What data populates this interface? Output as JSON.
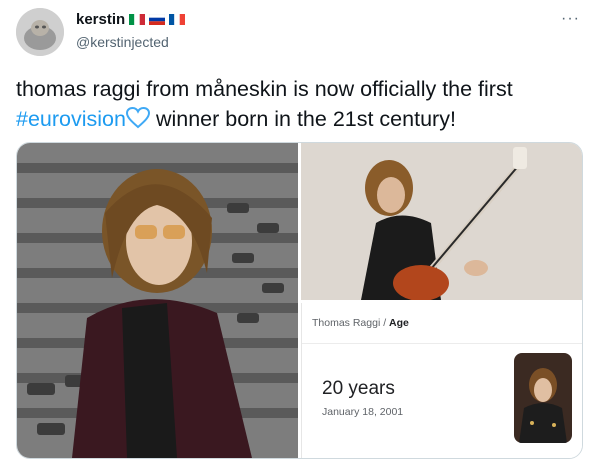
{
  "tweet": {
    "display_name": "kerstin",
    "flags": [
      "italy-flag",
      "russia-flag",
      "france-flag"
    ],
    "handle": "@kerstinjected",
    "more_label": "···",
    "text_line1": "thomas raggi from måneskin is now officially the first",
    "hashtag": "#eurovision",
    "heart_icon": "blue-heart-icon",
    "text_line2_rest": " winner born in the 21st century!"
  },
  "card": {
    "breadcrumb_name": "Thomas Raggi",
    "breadcrumb_sep": "/",
    "breadcrumb_topic": "Age",
    "age": "20 years",
    "birth_date": "January 18, 2001"
  },
  "colors": {
    "link": "#1d9bf0",
    "heart": "#3fa9f5",
    "text": "#0f1419",
    "secondary": "#536471"
  }
}
